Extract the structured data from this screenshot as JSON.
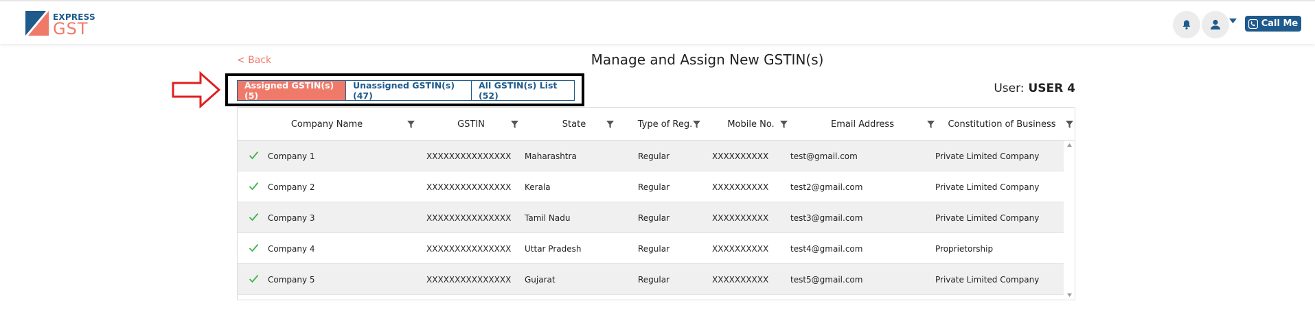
{
  "brand": {
    "top": "EXPRESS",
    "main": "GST"
  },
  "header": {
    "call_label": "Call Me"
  },
  "nav": {
    "back_label": "< Back"
  },
  "page": {
    "title": "Manage and Assign New GSTIN(s)"
  },
  "tabs": [
    {
      "label": "Assigned GSTIN(s) (5)",
      "active": true
    },
    {
      "label": "Unassigned GSTIN(s) (47)",
      "active": false
    },
    {
      "label": "All GSTIN(s) List (52)",
      "active": false
    }
  ],
  "user": {
    "label": "User:",
    "name": "USER 4"
  },
  "table": {
    "columns": [
      "Company Name",
      "GSTIN",
      "State",
      "Type of Reg.",
      "Mobile No.",
      "Email Address",
      "Constitution of Business"
    ],
    "rows": [
      {
        "company": "Company 1",
        "gstin": "XXXXXXXXXXXXXXX",
        "state": "Maharashtra",
        "type": "Regular",
        "mobile": "XXXXXXXXXX",
        "email": "test@gmail.com",
        "constitution": "Private Limited Company"
      },
      {
        "company": "Company 2",
        "gstin": "XXXXXXXXXXXXXXX",
        "state": "Kerala",
        "type": "Regular",
        "mobile": "XXXXXXXXXX",
        "email": "test2@gmail.com",
        "constitution": "Private Limited Company"
      },
      {
        "company": "Company 3",
        "gstin": "XXXXXXXXXXXXXXX",
        "state": "Tamil Nadu",
        "type": "Regular",
        "mobile": "XXXXXXXXXX",
        "email": "test3@gmail.com",
        "constitution": "Private Limited Company"
      },
      {
        "company": "Company 4",
        "gstin": "XXXXXXXXXXXXXXX",
        "state": "Uttar Pradesh",
        "type": "Regular",
        "mobile": "XXXXXXXXXX",
        "email": "test4@gmail.com",
        "constitution": "Proprietorship"
      },
      {
        "company": "Company 5",
        "gstin": "XXXXXXXXXXXXXXX",
        "state": "Gujarat",
        "type": "Regular",
        "mobile": "XXXXXXXXXX",
        "email": "test5@gmail.com",
        "constitution": "Private Limited Company"
      }
    ]
  },
  "colors": {
    "brand_blue": "#1e5a8c",
    "accent_coral": "#f07a6a",
    "check_green": "#3cb44b",
    "callout_red": "#e02020"
  },
  "icons": {
    "notifications": "bell-icon",
    "profile": "user-icon",
    "menu": "caret-down-icon",
    "call": "phone-icon",
    "filter": "filter-icon",
    "selected": "check-icon",
    "pointer": "arrow-right-icon"
  }
}
